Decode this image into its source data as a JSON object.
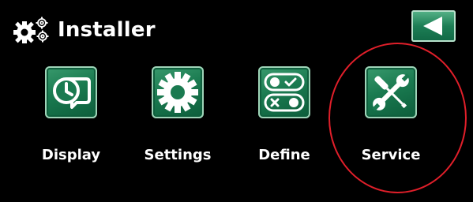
{
  "header": {
    "title": "Installer",
    "icon": "gears-icon",
    "back_icon": "back-arrow-icon"
  },
  "menu": [
    {
      "label": "Display",
      "icon": "clock-display-icon"
    },
    {
      "label": "Settings",
      "icon": "gear-icon"
    },
    {
      "label": "Define",
      "icon": "toggle-switches-icon"
    },
    {
      "label": "Service",
      "icon": "tools-icon"
    }
  ],
  "colors": {
    "background": "#000000",
    "button_green": "#1a7a50",
    "highlight": "#e01f2a",
    "text": "#ffffff"
  }
}
